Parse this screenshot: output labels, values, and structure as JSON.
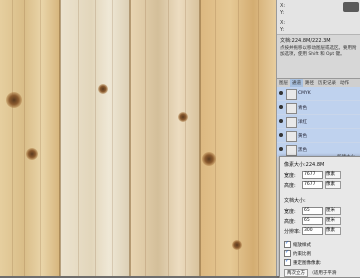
{
  "info_panel": {
    "pointer_labels": [
      "X:",
      "Y:",
      "X:",
      "Y:"
    ],
    "doc_size": "文档:224.8M/222.3M",
    "hint": "点按并拖移以移动图层或选区。要用附加选项，使用 Shift 和 Opt 键。"
  },
  "layers_panel": {
    "tabs": [
      "图层",
      "通道",
      "路径",
      "历史记录",
      "动作"
    ],
    "rows": [
      {
        "name": "CMYK"
      },
      {
        "name": "青色"
      },
      {
        "name": "洋红"
      },
      {
        "name": "黄色"
      },
      {
        "name": "黑色"
      }
    ],
    "footer": "新建大小"
  },
  "image_size_dialog": {
    "pixel_dims_label": "像素大小:224.8M",
    "width_label": "宽度:",
    "width_value": "7677",
    "height_label": "高度:",
    "height_value": "7677",
    "pixel_unit": "像素",
    "doc_size_label": "文档大小:",
    "doc_width_value": "65",
    "doc_height_value": "65",
    "resolution_label": "分辨率:",
    "resolution_value": "300",
    "cm_unit": "厘米",
    "res_unit": "像素",
    "checkboxes": [
      "缩放样式",
      "约束比例",
      "重定图像像素:"
    ],
    "resample_label": "两次立方",
    "resample_desc": "（适用于平滑"
  },
  "colors": {
    "accent": "#bfd2ee",
    "panel_bg": "#d7d7d7",
    "dialog_bg": "#e8e8e8"
  }
}
